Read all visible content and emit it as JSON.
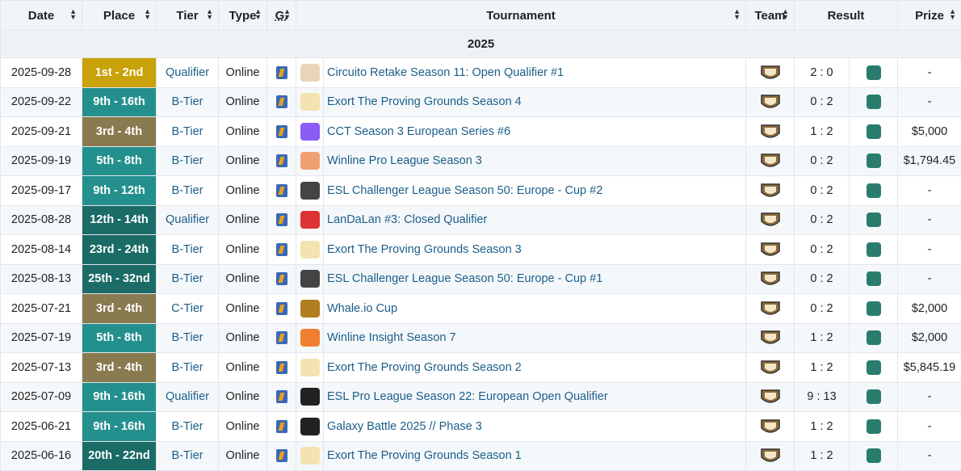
{
  "headers": {
    "date": "Date",
    "place": "Place",
    "tier": "Tier",
    "type": "Type",
    "g": "G.",
    "tournament": "Tournament",
    "team": "Team",
    "result": "Result",
    "prize": "Prize"
  },
  "year": "2025",
  "rows": [
    {
      "date": "2025-09-28",
      "place": "1st - 2nd",
      "place_color": "gold",
      "tier": "Qualifier",
      "type": "Online",
      "tournament": "Circuito Retake Season 11: Open Qualifier #1",
      "tournament_icon": "retake-icon",
      "score": "2 : 0",
      "opponent_icon": "opponent-logo-icon",
      "prize": "-"
    },
    {
      "date": "2025-09-22",
      "place": "9th - 16th",
      "place_color": "teal",
      "tier": "B-Tier",
      "type": "Online",
      "tournament": "Exort The Proving Grounds Season 4",
      "tournament_icon": "exort-icon",
      "score": "0 : 2",
      "opponent_icon": "fnatic-logo-icon",
      "prize": "-"
    },
    {
      "date": "2025-09-21",
      "place": "3rd - 4th",
      "place_color": "bronze",
      "tier": "B-Tier",
      "type": "Online",
      "tournament": "CCT Season 3 European Series #6",
      "tournament_icon": "cct-icon",
      "score": "1 : 2",
      "opponent_icon": "bb-logo-icon",
      "prize": "$5,000"
    },
    {
      "date": "2025-09-19",
      "place": "5th - 8th",
      "place_color": "teal",
      "tier": "B-Tier",
      "type": "Online",
      "tournament": "Winline Pro League Season 3",
      "tournament_icon": "winline-icon",
      "score": "0 : 2",
      "opponent_icon": "aurora-logo-icon",
      "prize": "$1,794.45"
    },
    {
      "date": "2025-09-17",
      "place": "9th - 12th",
      "place_color": "teal",
      "tier": "B-Tier",
      "type": "Online",
      "tournament": "ESL Challenger League Season 50: Europe - Cup #2",
      "tournament_icon": "esl-icon",
      "score": "0 : 2",
      "opponent_icon": "opponent-logo-icon",
      "prize": "-"
    },
    {
      "date": "2025-08-28",
      "place": "12th - 14th",
      "place_color": "dteal",
      "tier": "Qualifier",
      "type": "Online",
      "tournament": "LanDaLan #3: Closed Qualifier",
      "tournament_icon": "landalan-icon",
      "score": "0 : 2",
      "opponent_icon": "opponent-logo-icon",
      "prize": "-"
    },
    {
      "date": "2025-08-14",
      "place": "23rd - 24th",
      "place_color": "dteal",
      "tier": "B-Tier",
      "type": "Online",
      "tournament": "Exort The Proving Grounds Season 3",
      "tournament_icon": "exort-icon",
      "score": "0 : 2",
      "opponent_icon": "opponent-logo-icon",
      "prize": "-"
    },
    {
      "date": "2025-08-13",
      "place": "25th - 32nd",
      "place_color": "dteal",
      "tier": "B-Tier",
      "type": "Online",
      "tournament": "ESL Challenger League Season 50: Europe - Cup #1",
      "tournament_icon": "esl-icon",
      "score": "0 : 2",
      "opponent_icon": "opponent-logo-icon",
      "prize": "-"
    },
    {
      "date": "2025-07-21",
      "place": "3rd - 4th",
      "place_color": "bronze",
      "tier": "C-Tier",
      "type": "Online",
      "tournament": "Whale.io Cup",
      "tournament_icon": "whale-icon",
      "score": "0 : 2",
      "opponent_icon": "opponent-logo-icon",
      "prize": "$2,000"
    },
    {
      "date": "2025-07-19",
      "place": "5th - 8th",
      "place_color": "teal",
      "tier": "B-Tier",
      "type": "Online",
      "tournament": "Winline Insight Season 7",
      "tournament_icon": "winline-insight-icon",
      "score": "1 : 2",
      "opponent_icon": "opponent-logo-icon",
      "prize": "$2,000"
    },
    {
      "date": "2025-07-13",
      "place": "3rd - 4th",
      "place_color": "bronze",
      "tier": "B-Tier",
      "type": "Online",
      "tournament": "Exort The Proving Grounds Season 2",
      "tournament_icon": "exort-icon",
      "score": "1 : 2",
      "opponent_icon": "opponent-logo-icon",
      "prize": "$5,845.19"
    },
    {
      "date": "2025-07-09",
      "place": "9th - 16th",
      "place_color": "teal",
      "tier": "Qualifier",
      "type": "Online",
      "tournament": "ESL Pro League Season 22: European Open Qualifier",
      "tournament_icon": "esl-pro-icon",
      "score": "9 : 13",
      "opponent_icon": "opponent-logo-icon",
      "prize": "-"
    },
    {
      "date": "2025-06-21",
      "place": "9th - 16th",
      "place_color": "teal",
      "tier": "B-Tier",
      "type": "Online",
      "tournament": "Galaxy Battle 2025 // Phase 3",
      "tournament_icon": "galaxy-icon",
      "score": "1 : 2",
      "opponent_icon": "opponent-logo-icon",
      "prize": "-"
    },
    {
      "date": "2025-06-16",
      "place": "20th - 22nd",
      "place_color": "dteal",
      "tier": "B-Tier",
      "type": "Online",
      "tournament": "Exort The Proving Grounds Season 1",
      "tournament_icon": "exort-icon",
      "score": "1 : 2",
      "opponent_icon": "opponent-logo-icon",
      "prize": "-"
    }
  ]
}
